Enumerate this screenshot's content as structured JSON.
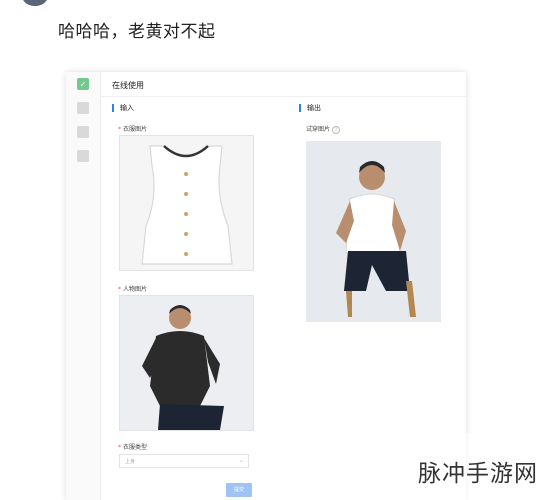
{
  "post": {
    "title": "哈哈哈，老黄对不起"
  },
  "panel": {
    "title": "在线使用",
    "nav_icons": [
      "check-icon",
      "image-icon",
      "edit-icon",
      "settings-icon"
    ],
    "input_section": "输入",
    "output_section": "输出",
    "fields": {
      "clothes_image": "衣服图片",
      "person_image": "人物图片",
      "clothes_type": "衣服类型",
      "result_image": "试穿图片"
    },
    "required_mark": "*",
    "clothes_type_value": "上身",
    "submit_label": "提交"
  },
  "watermark": "脉冲手游网",
  "colors": {
    "accent": "#2f80ed",
    "active_nav": "#73c98b",
    "submit_bg": "#9fc3f5"
  }
}
